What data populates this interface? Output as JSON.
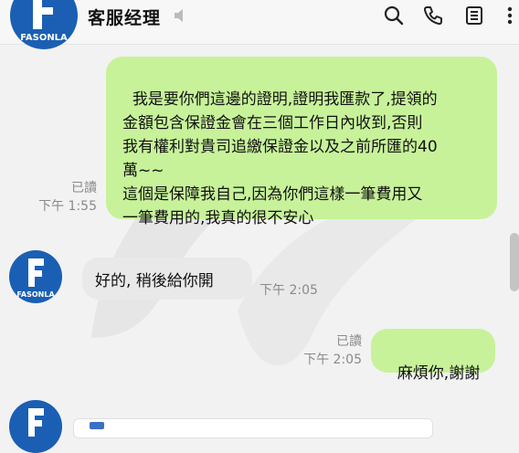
{
  "header": {
    "title": "客服经理",
    "avatar_brand": "FASONLA",
    "icons": [
      "mute-icon",
      "search-icon",
      "phone-icon",
      "notes-icon",
      "more-vertical-icon"
    ]
  },
  "avatar_brand": "FASONLA",
  "messages": [
    {
      "direction": "outgoing",
      "text": "我是要你們這邊的證明,證明我匯款了,提領的\n金額包含保證金會在三個工作日內收到,否則\n我有權利對貴司追繳保證金以及之前所匯的40\n萬~~\n這個是保障我自己,因為你們這樣一筆費用又\n一筆費用的,我真的很不安心",
      "read": "已讀",
      "time": "下午 1:55"
    },
    {
      "direction": "incoming",
      "text": "好的, 稍後給你開",
      "time": "下午 2:05"
    },
    {
      "direction": "outgoing",
      "text": "麻煩你,謝謝",
      "read": "已讀",
      "time": "下午 2:05"
    }
  ],
  "colors": {
    "outgoing_bubble": "#c7f29a",
    "incoming_bubble": "#e9e9e9",
    "avatar_blue": "#1a5fb4",
    "background": "#f2f2f2"
  }
}
